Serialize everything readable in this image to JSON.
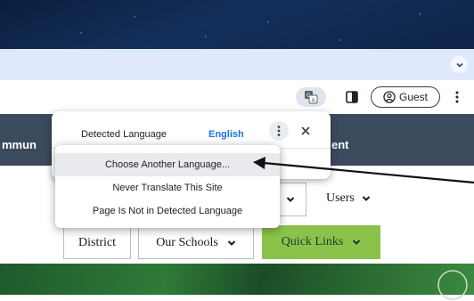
{
  "browser": {
    "profile_label": "Guest",
    "icons": {
      "translate": "translate-icon",
      "side_panel": "side-panel-icon",
      "profile": "account-circle-icon",
      "menu": "kebab-menu-icon",
      "tab_search": "chevron-down-icon"
    }
  },
  "site_nav": {
    "left_partial": "mmun",
    "right_partial": "ent"
  },
  "translate_popup": {
    "tabs": [
      "Detected Language",
      "English"
    ],
    "active_tab": "English",
    "menu_items": [
      "Choose Another Language...",
      "Never Translate This Site",
      "Page Is Not in Detected Language"
    ],
    "selected_item": "Choose Another Language..."
  },
  "filters": {
    "users_label": "Users",
    "district_label": "District",
    "our_schools_label": "Our Schools",
    "quick_links_label": "Quick Links"
  },
  "colors": {
    "chrome_dark": "#0b1f3d",
    "tabstrip": "#dfe9fb",
    "site_nav": "#3b4a5c",
    "accent_blue": "#1a73e8",
    "quick_links": "#8bc34a",
    "hero_green": "#2f7a38"
  }
}
